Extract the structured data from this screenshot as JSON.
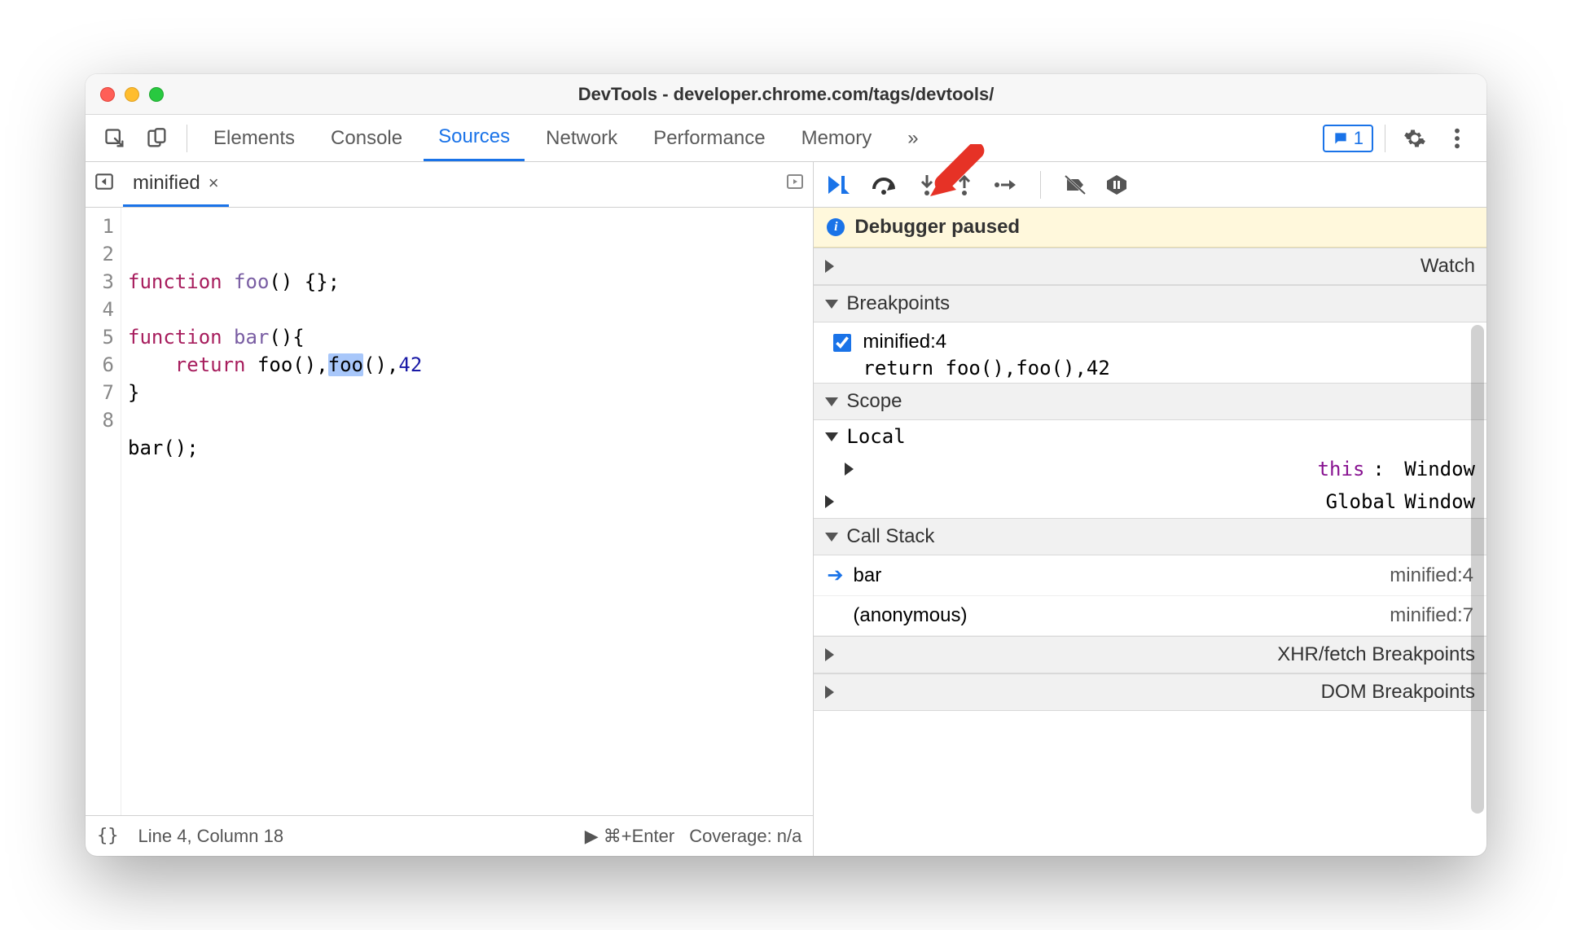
{
  "window": {
    "title": "DevTools - developer.chrome.com/tags/devtools/"
  },
  "tabs": {
    "items": [
      "Elements",
      "Console",
      "Sources",
      "Network",
      "Performance",
      "Memory"
    ],
    "active": "Sources",
    "overflow": "»",
    "issue_count": "1"
  },
  "file_tabs": {
    "active": "minified",
    "close": "×"
  },
  "code": {
    "gutter": [
      "1",
      "2",
      "3",
      "4",
      "5",
      "6",
      "7",
      "8"
    ],
    "lines": {
      "l1_kw": "function",
      "l1_fn1": "foo",
      "l1_rest": "() {};",
      "l3_kw": "function",
      "l3_fn": "bar",
      "l3_rest": "(){",
      "l4_indent": "    ",
      "l4_kw": "return",
      "l4_sp": " ",
      "l4_c1": "foo(),",
      "l4_hl": "foo",
      "l4_c2": "(),",
      "l4_num": "42",
      "l5": "}",
      "l7": "bar();"
    }
  },
  "status": {
    "braces": "{}",
    "pos": "Line 4, Column 18",
    "run": "▶ ⌘+Enter",
    "coverage": "Coverage: n/a"
  },
  "debug": {
    "notice": "Debugger paused",
    "sections": {
      "watch": "Watch",
      "breakpoints": "Breakpoints",
      "scope": "Scope",
      "callstack": "Call Stack",
      "xhr": "XHR/fetch Breakpoints",
      "dom": "DOM Breakpoints"
    },
    "breakpoints": [
      {
        "label": "minified:4",
        "code": "return foo(),foo(),42",
        "checked": true
      }
    ],
    "scope": {
      "local": "Local",
      "this_label": "this",
      "this_value": "Window",
      "global": "Global",
      "global_value": "Window"
    },
    "callstack": [
      {
        "fn": "bar",
        "loc": "minified:4",
        "current": true
      },
      {
        "fn": "(anonymous)",
        "loc": "minified:7",
        "current": false
      }
    ]
  }
}
